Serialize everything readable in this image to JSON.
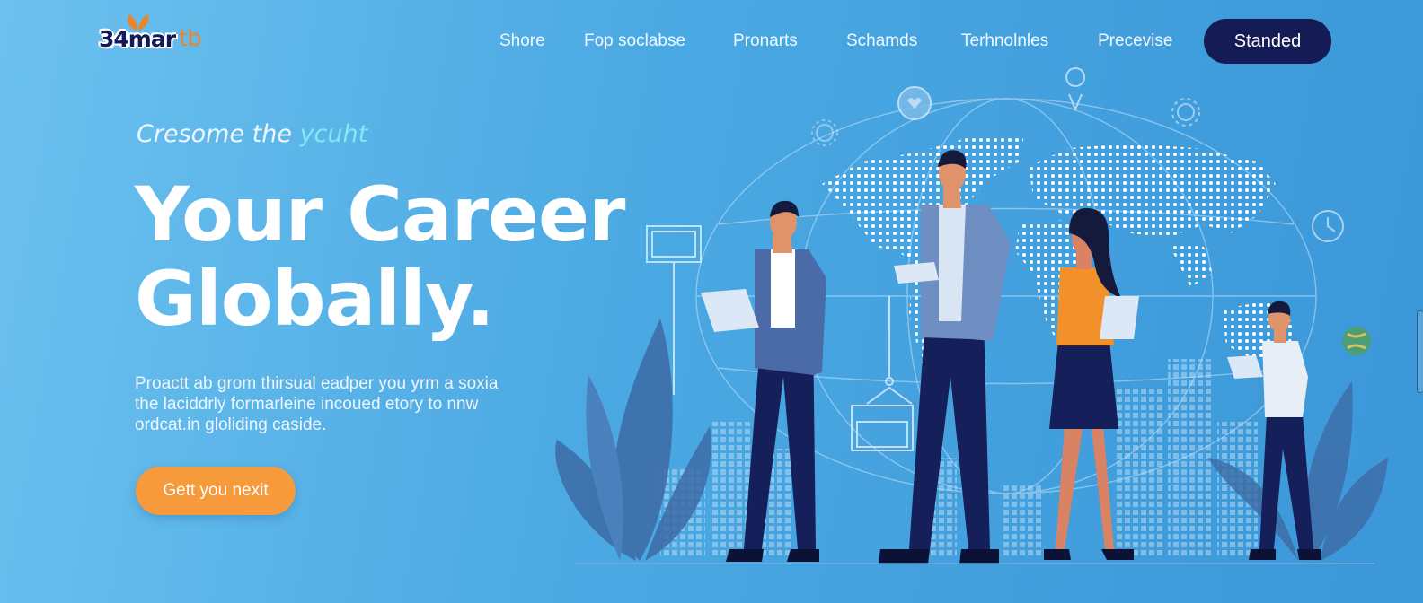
{
  "brand": {
    "logo_text": "34mar",
    "logo_suffix": "tb",
    "colors": {
      "navy": "#141b55",
      "orange": "#f79a3b",
      "accent": "#7fe9f4",
      "background": "#4aa8e2"
    }
  },
  "nav": {
    "links": [
      {
        "label": "Shore"
      },
      {
        "label": "Fop soclabse"
      },
      {
        "label": "Pronarts"
      },
      {
        "label": "Schamds"
      },
      {
        "label": "Terhnolnles"
      },
      {
        "label": "Precevise"
      }
    ],
    "cta_label": "Standed"
  },
  "hero": {
    "eyebrow_prefix": "Cresome the",
    "eyebrow_accent": "ycuht",
    "headline_line1": "Your Career",
    "headline_line2": "Globally.",
    "description_lines": [
      "Proactt ab grom thirsual eadper you yrm a soxia",
      "the laciddrly formarleine incoued etory to nnw",
      "ordcat.in gloliding caside."
    ],
    "cta_label": "Gett you nexit"
  },
  "illustration": {
    "icons": [
      "heart-icon",
      "location-pin-icon",
      "gear-icon",
      "clock-icon",
      "globe-icon",
      "gear-icon"
    ],
    "scene": "world-map-with-professionals"
  }
}
